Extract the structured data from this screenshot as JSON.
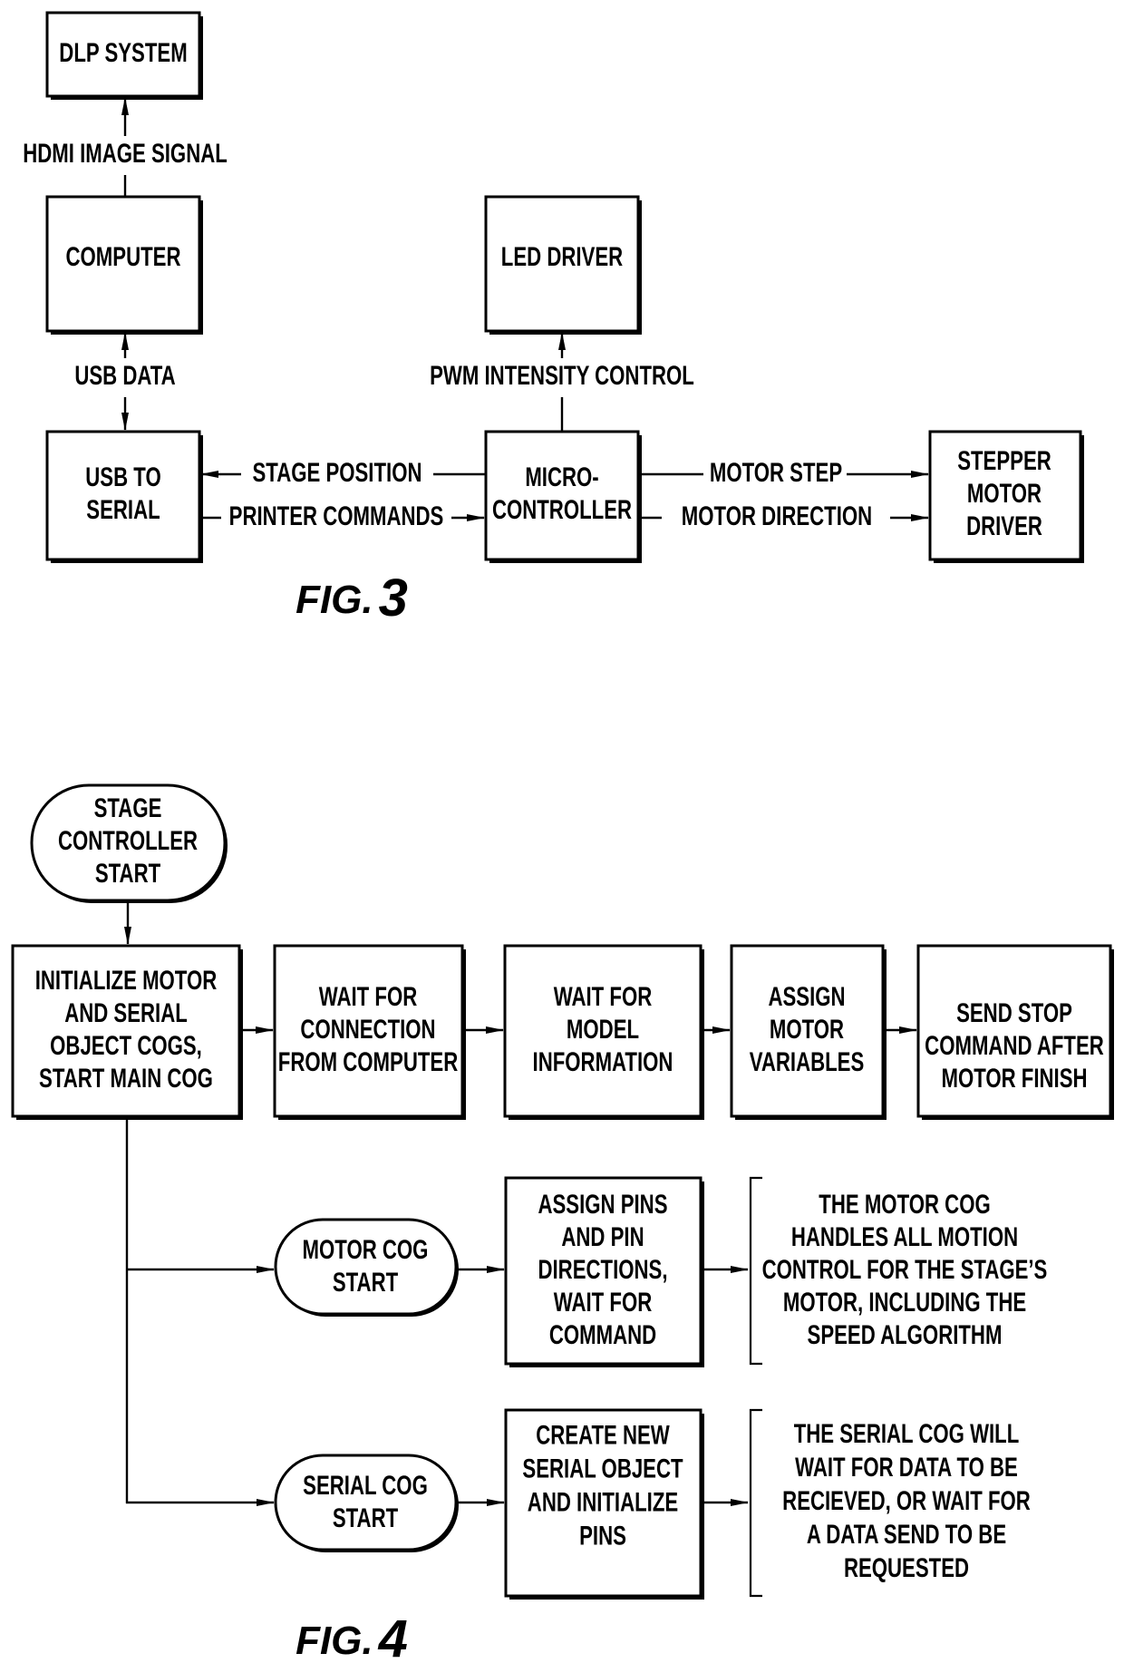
{
  "fig3": {
    "caption_prefix": "FIG.",
    "caption_number": "3",
    "blocks": {
      "dlp_system": [
        "DLP SYSTEM"
      ],
      "computer": [
        "COMPUTER"
      ],
      "usb_to_serial": [
        "USB TO",
        "SERIAL"
      ],
      "led_driver": [
        "LED DRIVER"
      ],
      "microcontroller": [
        "MICRO-",
        "CONTROLLER"
      ],
      "stepper_motor_driver": [
        "STEPPER",
        "MOTOR",
        "DRIVER"
      ]
    },
    "signals": {
      "hdmi_image_signal": "HDMI IMAGE SIGNAL",
      "usb_data": "USB DATA",
      "pwm_intensity_control": "PWM INTENSITY CONTROL",
      "stage_position": "STAGE POSITION",
      "printer_commands": "PRINTER COMMANDS",
      "motor_step": "MOTOR STEP",
      "motor_direction": "MOTOR DIRECTION"
    }
  },
  "fig4": {
    "caption_prefix": "FIG.",
    "caption_number": "4",
    "start": [
      "STAGE",
      "CONTROLLER",
      "START"
    ],
    "main_steps": [
      [
        "INITIALIZE MOTOR",
        "AND SERIAL",
        "OBJECT COGS,",
        "START MAIN COG"
      ],
      [
        "WAIT FOR",
        "CONNECTION",
        "FROM COMPUTER"
      ],
      [
        "WAIT FOR",
        "MODEL",
        "INFORMATION"
      ],
      [
        "ASSIGN",
        "MOTOR",
        "VARIABLES"
      ],
      [
        "SEND STOP",
        "COMMAND AFTER",
        "MOTOR FINISH"
      ]
    ],
    "motor_cog": {
      "start": [
        "MOTOR COG",
        "START"
      ],
      "step": [
        "ASSIGN PINS",
        "AND PIN",
        "DIRECTIONS,",
        "WAIT FOR",
        "COMMAND"
      ],
      "note": [
        "THE MOTOR COG",
        "HANDLES ALL MOTION",
        "CONTROL FOR THE STAGE’S",
        "MOTOR, INCLUDING THE",
        "SPEED ALGORITHM"
      ]
    },
    "serial_cog": {
      "start": [
        "SERIAL COG",
        "START"
      ],
      "step": [
        "CREATE NEW",
        "SERIAL OBJECT",
        "AND INITIALIZE",
        "PINS"
      ],
      "note": [
        "THE SERIAL COG WILL",
        "WAIT FOR DATA TO BE",
        "RECIEVED, OR WAIT FOR",
        "A DATA SEND TO BE",
        "REQUESTED"
      ]
    }
  }
}
